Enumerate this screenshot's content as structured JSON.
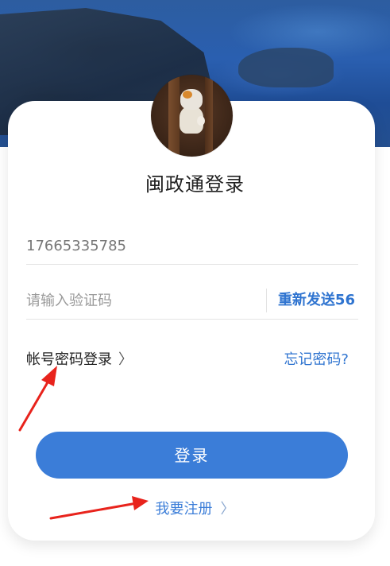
{
  "header": {
    "title": "闽政通登录"
  },
  "form": {
    "phone_value": "17665335785",
    "code_placeholder": "请输入验证码",
    "resend_label": "重新发送56"
  },
  "links": {
    "account_login": "帐号密码登录",
    "account_login_chevron": "〉",
    "forgot_password": "忘记密码?"
  },
  "actions": {
    "login_label": "登录",
    "register_label": "我要注册",
    "register_chevron": "〉"
  },
  "colors": {
    "accent": "#3b7dd8",
    "link": "#2f74d0",
    "annotation_arrow": "#e8231c"
  },
  "icons": {
    "chevron": "chevron-right-icon",
    "arrow_annotations": "red-arrow-icon"
  }
}
